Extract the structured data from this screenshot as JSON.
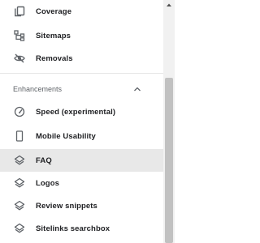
{
  "nav": {
    "top_items": [
      {
        "label": "Coverage",
        "icon": "coverage-icon"
      },
      {
        "label": "Sitemaps",
        "icon": "sitemaps-icon"
      },
      {
        "label": "Removals",
        "icon": "removals-icon"
      }
    ],
    "section": {
      "label": "Enhancements",
      "expanded": true
    },
    "section_items": [
      {
        "label": "Speed (experimental)",
        "icon": "speed-icon"
      },
      {
        "label": "Mobile Usability",
        "icon": "mobile-icon"
      },
      {
        "label": "FAQ",
        "icon": "enhancement-icon",
        "active": true
      },
      {
        "label": "Logos",
        "icon": "enhancement-icon"
      },
      {
        "label": "Review snippets",
        "icon": "enhancement-icon"
      },
      {
        "label": "Sitelinks searchbox",
        "icon": "enhancement-icon"
      }
    ]
  },
  "colors": {
    "text": "#202124",
    "section_text": "#5f6368",
    "active_bg": "#e8e8e8",
    "icon": "#5f6368"
  }
}
